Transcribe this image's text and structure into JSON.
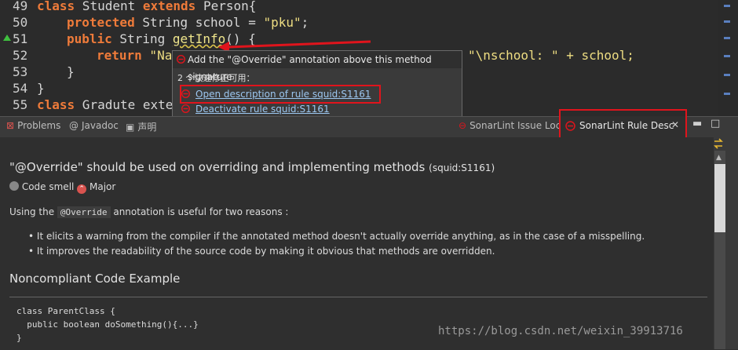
{
  "editor": {
    "line_numbers": [
      "49",
      "50",
      "51",
      "52",
      "53",
      "54",
      "55"
    ],
    "lines": {
      "l49": {
        "kw1": "class",
        "t1": " Student ",
        "kw2": "extends",
        "t2": " Person{"
      },
      "l50": {
        "kw1": "protected",
        "t1": " String school = ",
        "str": "\"pku\"",
        "t2": ";"
      },
      "l51": {
        "kw1": "public",
        "t1": " String ",
        "method": "getInfo",
        "t2": "() {"
      },
      "l52_left": {
        "kw1": "return",
        "t1": " \"Na"
      },
      "l52_right": {
        "t1": "\"\\nschool: \" + school;"
      },
      "l53": "}",
      "l54": "}",
      "l55": {
        "kw1": "class",
        "t1": " Gradute exte"
      }
    }
  },
  "quickfix": {
    "title": "Add the \"@Override\" annotation above this method signature",
    "subtitle": "2 个快速修正可用：",
    "items": [
      {
        "label": "Open description of rule squid:S1161"
      },
      {
        "label": "Deactivate rule squid:S1161"
      }
    ]
  },
  "tabs": {
    "problems": "Problems",
    "javadoc": "Javadoc",
    "declaration": "声明",
    "issue_locations": "SonarLint Issue Loc",
    "rule_desc": "SonarLint Rule Desc"
  },
  "rule": {
    "title": "\"@Override\" should be used on overriding and implementing methods",
    "key": "(squid:S1161)",
    "type": "Code smell",
    "severity": "Major",
    "intro_before": "Using the ",
    "intro_code": "@Override",
    "intro_after": " annotation is useful for two reasons :",
    "bullets": [
      "It elicits a warning from the compiler if the annotated method doesn't actually override anything, as in the case of a misspelling.",
      "It improves the readability of the source code by making it obvious that methods are overridden."
    ],
    "noncompliant_heading": "Noncompliant Code Example",
    "code_lines": [
      "class ParentClass {",
      "  public boolean doSomething(){...}",
      "}"
    ]
  },
  "watermark": "https://blog.csdn.net/weixin_39913716",
  "colors": {
    "accent_red": "#e0141c",
    "keyword": "#ef7b3a",
    "link": "#9cc7f0"
  }
}
